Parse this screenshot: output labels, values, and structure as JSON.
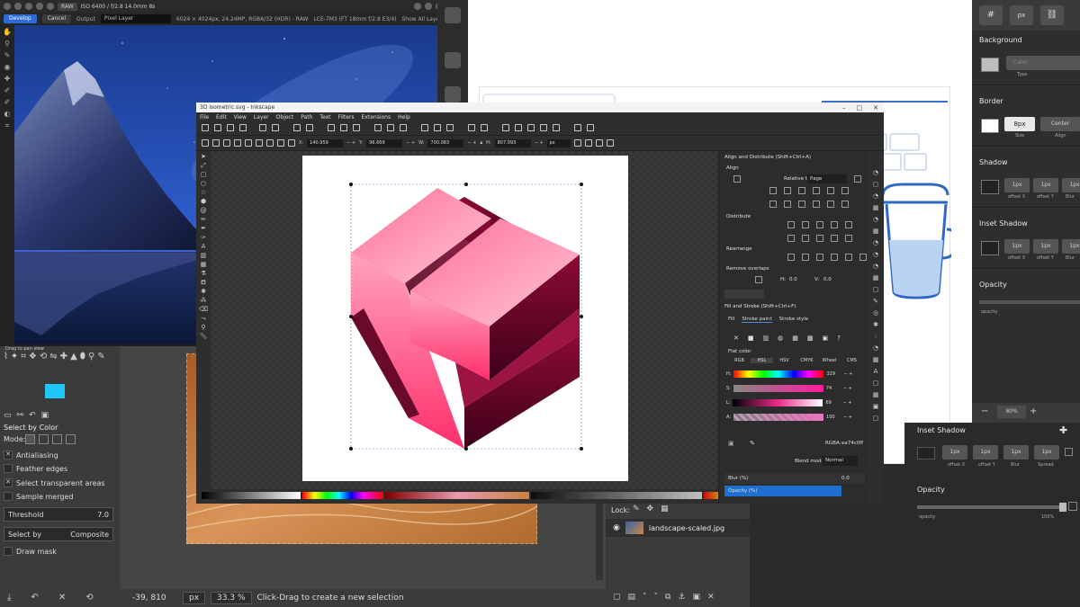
{
  "raw_editor": {
    "toolbar_items": [
      "RAW",
      "ISO 6400 / f/2.8 14.0mm 8s"
    ],
    "develop_label": "Develop",
    "cancel_label": "Cancel",
    "output_label": "Output",
    "output_value": "Pixel Layer",
    "info_text": "6024 × 4024px, 24.24MP, RGBA/32 (HDR) - RAW",
    "lens_text": "LCE-7M3 (FT 18mm f/2.8 E3/4)",
    "show_all_layers": "Show All Layers",
    "drag_hint": "Drag to pan view"
  },
  "web_style_panel": {
    "background_label": "Background",
    "color_placeholder": "Color",
    "type_caption": "Type",
    "border_label": "Border",
    "border_size": "8px",
    "border_align": "Center",
    "size_caption": "Size",
    "align_caption": "Align",
    "shadow_label": "Shadow",
    "shadow_values": [
      "1px",
      "1px",
      "1px"
    ],
    "shadow_captions": [
      "offset X",
      "offset Y",
      "Blur"
    ],
    "inset_shadow_label": "Inset Shadow",
    "opacity_label": "Opacity",
    "opacity_caption": "opacity",
    "opacity_value": "80%",
    "top_buttons": [
      "#",
      "px",
      "link"
    ],
    "minus": "−",
    "plus": "+"
  },
  "web_style_panel_2": {
    "inset_shadow_label": "Inset Shadow",
    "values": [
      "1px",
      "1px",
      "1px",
      "1px"
    ],
    "captions": [
      "offset X",
      "offset Y",
      "Blur",
      "Spread"
    ],
    "opacity_label": "Opacity",
    "opacity_caption": "opacity",
    "opacity_value": "100%"
  },
  "gimp": {
    "tool_name": "Select by Color",
    "mode_label": "Mode:",
    "options": [
      {
        "label": "Antialiasing",
        "checked": true
      },
      {
        "label": "Feather edges",
        "checked": false
      },
      {
        "label": "Select transparent areas",
        "checked": true
      },
      {
        "label": "Sample merged",
        "checked": false
      }
    ],
    "threshold_label": "Threshold",
    "threshold_value": "7.0",
    "select_by_label": "Select by",
    "select_by_value": "Composite",
    "draw_mask_label": "Draw mask",
    "status_coords": "-39, 810",
    "status_unit": "px",
    "status_zoom": "33.3 %",
    "status_message": "Click-Drag to create a new selection",
    "lock_label": "Lock:",
    "layer_name": "landscape-scaled.jpg",
    "fg_color": "#1ec8ff"
  },
  "inkscape": {
    "window_title": "3D isometric.svg - Inkscape",
    "window_controls": [
      "–",
      "□",
      "✕"
    ],
    "menus": [
      "File",
      "Edit",
      "View",
      "Layer",
      "Object",
      "Path",
      "Text",
      "Filters",
      "Extensions",
      "Help"
    ],
    "x_label": "X:",
    "x_value": "140.959",
    "y_label": "Y:",
    "y_value": "96.669",
    "w_label": "W:",
    "w_value": "700.083",
    "h_label": "H:",
    "h_value": "807.093",
    "unit": "px",
    "dock": {
      "align_title": "Align and Distribute (Shift+Ctrl+A)",
      "align_label": "Align",
      "relative_to_label": "Relative to:",
      "relative_to_value": "Page",
      "distribute_label": "Distribute",
      "rearrange_label": "Rearrange",
      "remove_overlaps_label": "Remove overlaps",
      "h_label": "H:",
      "h_value": "0.0",
      "v_label": "V:",
      "v_value": "0.0",
      "fill_stroke_title": "Fill and Stroke (Shift+Ctrl+F)",
      "tabs": [
        "Fill",
        "Stroke paint",
        "Stroke style"
      ],
      "flat_color_label": "Flat color",
      "color_modes": [
        "RGB",
        "HSL",
        "HSV",
        "CMYK",
        "Wheel",
        "CMS"
      ],
      "sliders": [
        {
          "label": "H:",
          "value": "329"
        },
        {
          "label": "S:",
          "value": "74"
        },
        {
          "label": "L:",
          "value": "69"
        },
        {
          "label": "A:",
          "value": "100"
        }
      ],
      "rgba_label": "RGBA:",
      "rgba_value": "ea74c0ff",
      "blend_label": "Blend mode:",
      "blend_value": "Normal",
      "blur_label": "Blur (%)",
      "blur_value": "0.0",
      "opacity_label": "Opacity (%)"
    }
  }
}
